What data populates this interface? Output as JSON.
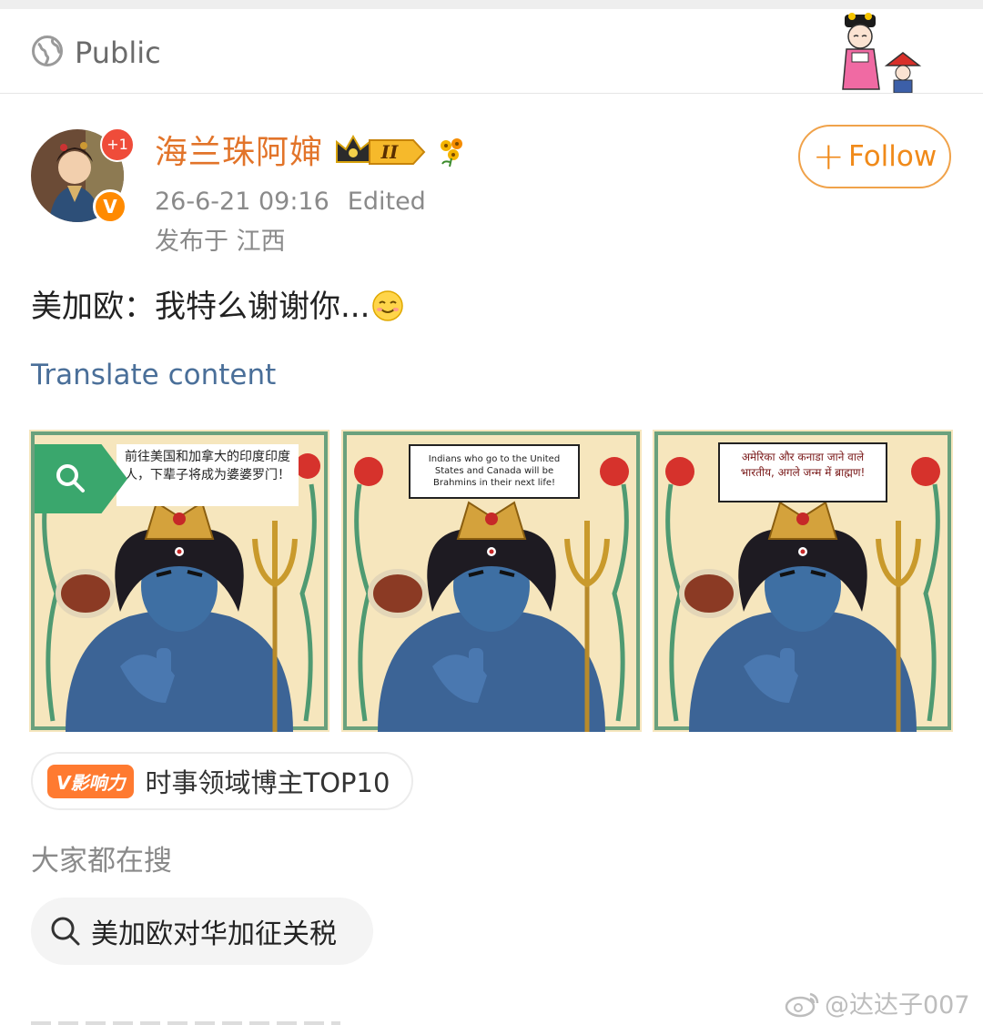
{
  "header": {
    "visibility_label": "Public",
    "icons": [
      "globe-icon",
      "decorative-sticker"
    ]
  },
  "author": {
    "name": "海兰珠阿婶",
    "avatar_badge": "+1",
    "verified_badge": "V",
    "level_badge": "II",
    "date": "26-6-21 09:16",
    "edited": "Edited",
    "location": "发布于 江西",
    "follow_label": "Follow",
    "colors": {
      "name": "#e2742a",
      "follow": "#f08a1a"
    }
  },
  "post": {
    "text": "美加欧：我特么谢谢你...",
    "emoji": "smile-emoji",
    "translate_label": "Translate content",
    "images": [
      {
        "caption": "前往美国和加拿大的印度印度人，下辈子将成为婆婆罗门！"
      },
      {
        "caption": "Indians who go to the United States and Canada will be Brahmins in their next life!"
      },
      {
        "caption": "अमेरिका और कनाडा जाने वाले भारतीय, अगले जन्म में ब्राह्मण!"
      }
    ]
  },
  "influence": {
    "tag": "V影响力",
    "text": "时事领域博主TOP10",
    "tag_color": "#ff7a30"
  },
  "search": {
    "heading": "大家都在搜",
    "query": "美加欧对华加征关税"
  },
  "watermark": "@达达子007"
}
